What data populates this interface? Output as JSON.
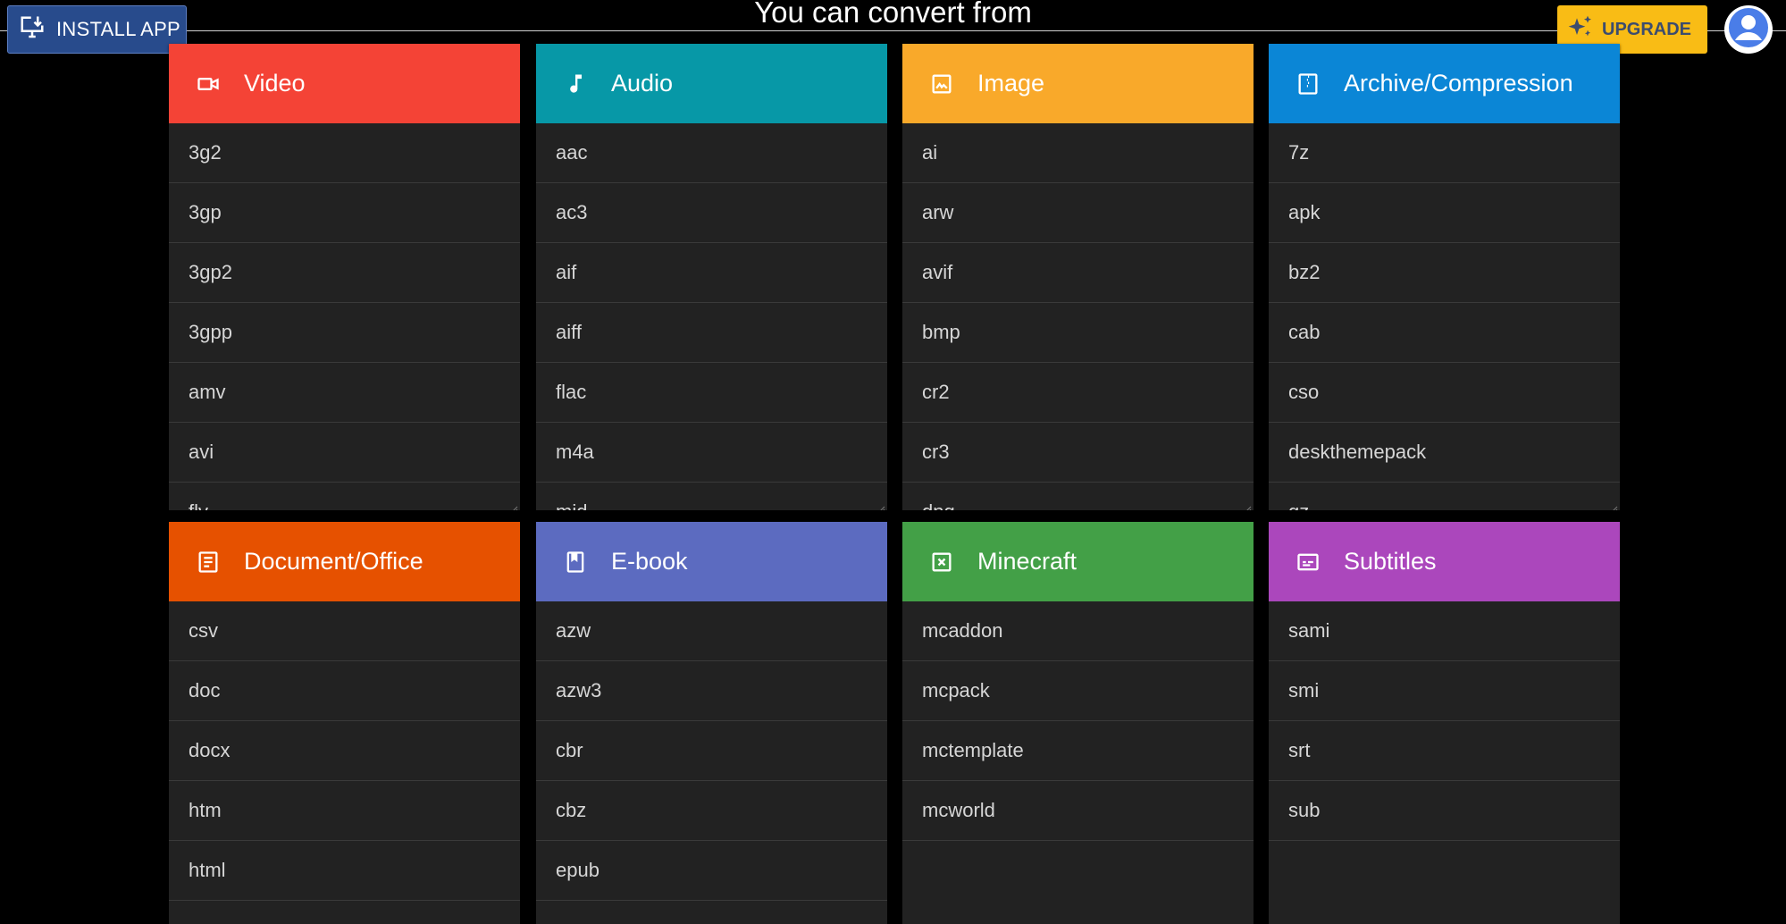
{
  "page_title": "You can convert from",
  "install_button": {
    "label": "INSTALL APP",
    "icon": "install-desktop-icon"
  },
  "upgrade_button": {
    "label": "UPGRADE",
    "icon": "sparkles-icon"
  },
  "account_button": {
    "icon": "account-circle-icon"
  },
  "categories": [
    {
      "title": "Video",
      "color": "#f44336",
      "icon": "videocam-icon",
      "items": [
        "3g2",
        "3gp",
        "3gp2",
        "3gpp",
        "amv",
        "avi",
        "flv"
      ]
    },
    {
      "title": "Audio",
      "color": "#0798a7",
      "icon": "music-note-icon",
      "items": [
        "aac",
        "ac3",
        "aif",
        "aiff",
        "flac",
        "m4a",
        "mid"
      ]
    },
    {
      "title": "Image",
      "color": "#f9a92a",
      "icon": "image-icon",
      "items": [
        "ai",
        "arw",
        "avif",
        "bmp",
        "cr2",
        "cr3",
        "dng"
      ]
    },
    {
      "title": "Archive/Compression",
      "color": "#0b86d6",
      "icon": "archive-icon",
      "items": [
        "7z",
        "apk",
        "bz2",
        "cab",
        "cso",
        "deskthemepack",
        "gz"
      ]
    },
    {
      "title": "Document/Office",
      "color": "#e65100",
      "icon": "document-icon",
      "items": [
        "csv",
        "doc",
        "docx",
        "htm",
        "html"
      ]
    },
    {
      "title": "E-book",
      "color": "#5c6bc0",
      "icon": "book-icon",
      "items": [
        "azw",
        "azw3",
        "cbr",
        "cbz",
        "epub"
      ]
    },
    {
      "title": "Minecraft",
      "color": "#43a047",
      "icon": "minecraft-block-icon",
      "items": [
        "mcaddon",
        "mcpack",
        "mctemplate",
        "mcworld"
      ]
    },
    {
      "title": "Subtitles",
      "color": "#ab47bc",
      "icon": "subtitles-icon",
      "items": [
        "sami",
        "smi",
        "srt",
        "sub"
      ]
    }
  ]
}
